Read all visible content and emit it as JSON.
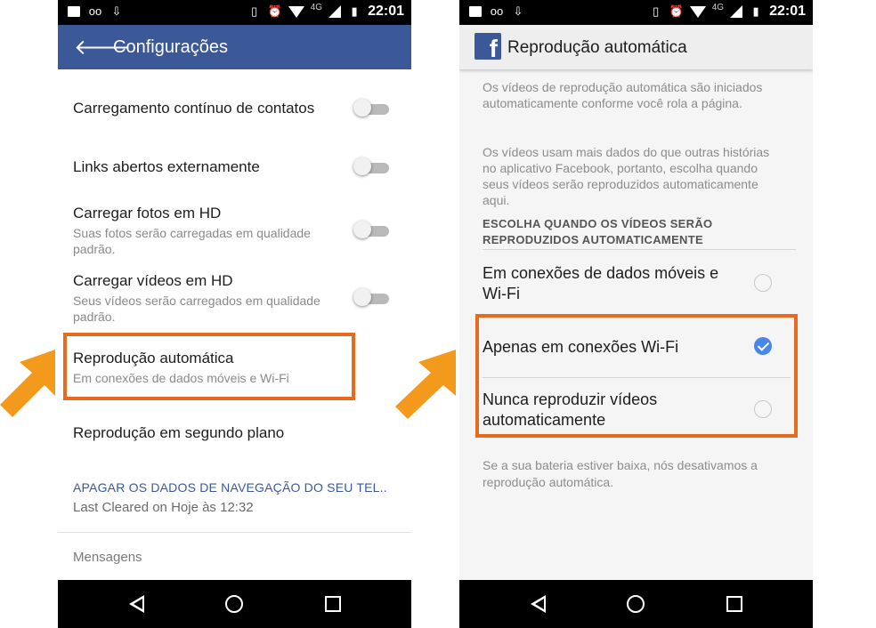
{
  "colors": {
    "facebook_blue": "#3b5998",
    "highlight_orange": "#e66b1f",
    "arrow_orange": "#f39a1c",
    "check_blue": "#4a86e8"
  },
  "statusbar": {
    "time": "22:01",
    "network": "4G"
  },
  "left": {
    "appbar": {
      "title": "Configurações"
    },
    "settings": [
      {
        "title": "Carregamento contínuo de contatos",
        "subtitle": "",
        "toggle": false
      },
      {
        "title": "Links abertos externamente",
        "subtitle": "",
        "toggle": false
      },
      {
        "title": "Carregar fotos em HD",
        "subtitle": "Suas fotos serão carregadas em qualidade padrão.",
        "toggle": false
      },
      {
        "title": "Carregar vídeos em HD",
        "subtitle": "Seus vídeos serão carregados em qualidade padrão.",
        "toggle": false
      },
      {
        "title": "Reprodução automática",
        "subtitle": "Em conexões de dados móveis e Wi-Fi"
      },
      {
        "title": "Reprodução em segundo plano",
        "subtitle": ""
      }
    ],
    "clear_data": {
      "link": "APAGAR OS DADOS DE NAVEGAÇÃO DO SEU TEL..",
      "last_cleared": "Last Cleared on Hoje às 12:32"
    },
    "section": "Mensagens"
  },
  "right": {
    "header": {
      "title": "Reprodução automática",
      "logo": "f"
    },
    "paragraphs": [
      "Os vídeos de reprodução automática são iniciados automaticamente conforme você rola a página.",
      "Os vídeos usam mais dados do que outras histórias no aplicativo Facebook, portanto, escolha quando seus vídeos serão reproduzidos automaticamente aqui."
    ],
    "section_heading": "ESCOLHA QUANDO OS VÍDEOS SERÃO REPRODUZIDOS AUTOMATICAMENTE",
    "options": [
      {
        "label": "Em conexões de dados móveis e Wi-Fi",
        "selected": false
      },
      {
        "label": "Apenas em conexões Wi-Fi",
        "selected": true
      },
      {
        "label": "Nunca reproduzir vídeos automaticamente",
        "selected": false
      }
    ],
    "footnote": "Se a sua bateria estiver baixa, nós desativamos a reprodução automática."
  }
}
